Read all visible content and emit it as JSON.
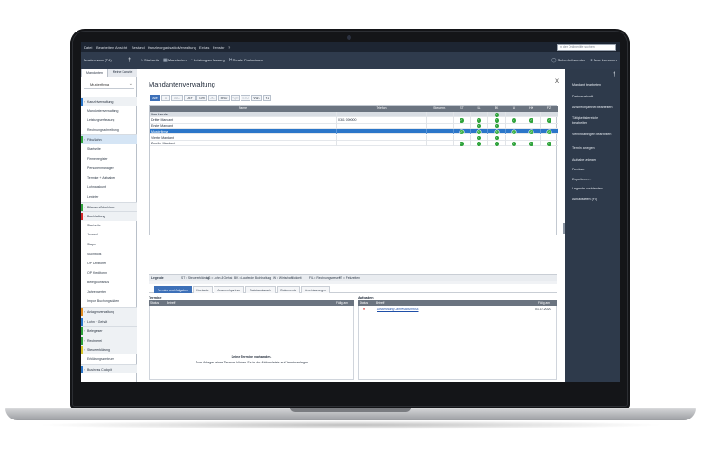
{
  "menubar": {
    "items": [
      "Datei",
      "Bearbeiten",
      "Ansicht",
      "Bestand",
      "Kanzleiorganisation",
      "Verwaltung",
      "Extras",
      "Fenster",
      "?"
    ],
    "search_placeholder": "In der Onlinehilfe suchen"
  },
  "toolbar": {
    "client_selector": "Mustermann (F4)",
    "pin_icon": "pin-icon",
    "items": [
      {
        "label": "Startseite",
        "icon": "home-icon"
      },
      {
        "label": "Mandanten",
        "icon": "clients-icon"
      },
      {
        "label": "Leistungserfassung",
        "icon": "timer-icon"
      },
      {
        "label": "Realtz Fachwissen",
        "icon": "knowledge-icon"
      }
    ],
    "security": "Sicherheitscenter",
    "user": "Max Lemann"
  },
  "leftnav": {
    "tabs": [
      "Mandanten",
      "Meine Kanzlei"
    ],
    "client_value": "Musterfirma",
    "items": [
      {
        "label": "Kanzleiverwaltung",
        "type": "group",
        "stripe": "#2b76c9"
      },
      {
        "label": "Mandantenverwaltung",
        "type": "sub"
      },
      {
        "label": "Leistungserfassung",
        "type": "sub"
      },
      {
        "label": "Rechnungsschreibung",
        "type": "sub"
      },
      {
        "label": "Fibu/Lohn",
        "type": "group",
        "stripe": "#2fa33b",
        "selected": true
      },
      {
        "label": "Startseite",
        "type": "sub"
      },
      {
        "label": "Firmenregister",
        "type": "sub"
      },
      {
        "label": "Personenmanager",
        "type": "sub"
      },
      {
        "label": "Termine + Aufgaben",
        "type": "sub"
      },
      {
        "label": "Lohnauskunft",
        "type": "sub"
      },
      {
        "label": "Lexinter",
        "type": "sub"
      },
      {
        "label": "Bilanzen/Abschluss",
        "type": "group",
        "stripe": "#2fa33b"
      },
      {
        "label": "Buchhaltung",
        "type": "group",
        "stripe": "#d42a2a"
      },
      {
        "label": "Startseite",
        "type": "sub"
      },
      {
        "label": "Journal",
        "type": "sub"
      },
      {
        "label": "Stapel",
        "type": "sub"
      },
      {
        "label": "Suchtools",
        "type": "sub"
      },
      {
        "label": "OP Debitoren",
        "type": "sub"
      },
      {
        "label": "OP Kreditoren",
        "type": "sub"
      },
      {
        "label": "Belegtourismus",
        "type": "sub"
      },
      {
        "label": "Jahreswerten",
        "type": "sub"
      },
      {
        "label": "Import Buchungsdaten",
        "type": "sub"
      },
      {
        "label": "Anlagenverwaltung",
        "type": "group",
        "stripe": "#e08a1e"
      },
      {
        "label": "Lohn + Gehalt",
        "type": "group",
        "stripe": "#2b76c9"
      },
      {
        "label": "Belegleser",
        "type": "group",
        "stripe": "#2fa33b"
      },
      {
        "label": "Rechnerei",
        "type": "group",
        "stripe": "#2fa33b"
      },
      {
        "label": "Steuererklärung",
        "type": "group",
        "stripe": "#d8c52a"
      },
      {
        "label": "Erklärungszentrum",
        "type": "sub"
      },
      {
        "label": "Business Cockpit",
        "type": "group",
        "stripe": "#2b76c9"
      }
    ]
  },
  "dialog": {
    "title": "Mandantenverwaltung",
    "close": "X",
    "letters": [
      {
        "label": "Alle",
        "state": "active"
      },
      {
        "label": "A",
        "state": "disabled"
      },
      {
        "label": "ABC",
        "state": "disabled"
      },
      {
        "label": "DEF",
        "state": "normal"
      },
      {
        "label": "GHI",
        "state": "normal"
      },
      {
        "label": "JKL",
        "state": "disabled"
      },
      {
        "label": "MNO",
        "state": "normal"
      },
      {
        "label": "PQR",
        "state": "disabled"
      },
      {
        "label": "STU",
        "state": "disabled"
      },
      {
        "label": "VWX",
        "state": "normal"
      },
      {
        "label": "YZ",
        "state": "normal"
      }
    ],
    "columns": [
      "Name",
      "Telefon",
      "Steuernr.",
      "ST",
      "SL",
      "BK",
      "W",
      "HK",
      "FZ"
    ],
    "rows": [
      {
        "name": "Ihre Kanzlei",
        "phone": "",
        "tax": "",
        "checks": [
          false,
          false,
          true,
          false,
          false,
          false
        ],
        "group": true
      },
      {
        "name": "Dritter Mandant",
        "phone": "0761 000000",
        "tax": "",
        "checks": [
          true,
          true,
          true,
          true,
          true,
          true
        ]
      },
      {
        "name": "Erster Mandant",
        "phone": "",
        "tax": "",
        "checks": [
          false,
          true,
          true,
          false,
          false,
          false
        ]
      },
      {
        "name": "Musterfirma",
        "phone": "",
        "tax": "",
        "checks": [
          true,
          true,
          true,
          true,
          true,
          true
        ],
        "selected": true
      },
      {
        "name": "Vierter Mandant",
        "phone": "",
        "tax": "",
        "checks": [
          false,
          true,
          true,
          false,
          false,
          false
        ]
      },
      {
        "name": "Zweiter Mandant",
        "phone": "",
        "tax": "",
        "checks": [
          true,
          true,
          true,
          true,
          true,
          true
        ]
      }
    ],
    "legend": {
      "title": "Legende",
      "entries": [
        "ST = Steuererklärung",
        "LG = Lohn & Gehalt",
        "BK = Laufende Buchhaltung",
        "W = Wirtschaftlichkeit",
        "FIL = Rechnungswesen",
        "FZ = Fehlzeiten"
      ]
    },
    "subtabs": [
      "Termine und Aufgaben",
      "Kontakte",
      "Ansprechpartner",
      "Dateiaustausch",
      "Dokumente",
      "Vereinbarungen"
    ],
    "termine": {
      "title": "Termine",
      "cols": [
        "Status",
        "Betreff",
        "Fällig am"
      ],
      "empty_title": "Keine Termine vorhanden.",
      "empty_hint": "Zum Anlegen eines Termins klicken Sie in der Aktionsleiste auf Termin anlegen."
    },
    "aufgaben": {
      "title": "Aufgaben",
      "cols": [
        "Status",
        "Betreff",
        "Fällig am"
      ],
      "rows": [
        {
          "subject": "Abstimmung Jahresabschluss",
          "due": "01.12.2020"
        }
      ]
    }
  },
  "rightpanel": {
    "actions": [
      "Mandant bearbeiten",
      "Datenauskunft",
      "Ansprechpartner bearbeiten",
      "Tätigkeitsbereiche bearbeiten",
      "Vereinbarungen bearbeiten",
      "Termin anlegen",
      "Aufgabe anlegen",
      "Drucken...",
      "Exportieren...",
      "Legende ausblenden",
      "Aktualisieren (F5)"
    ]
  }
}
